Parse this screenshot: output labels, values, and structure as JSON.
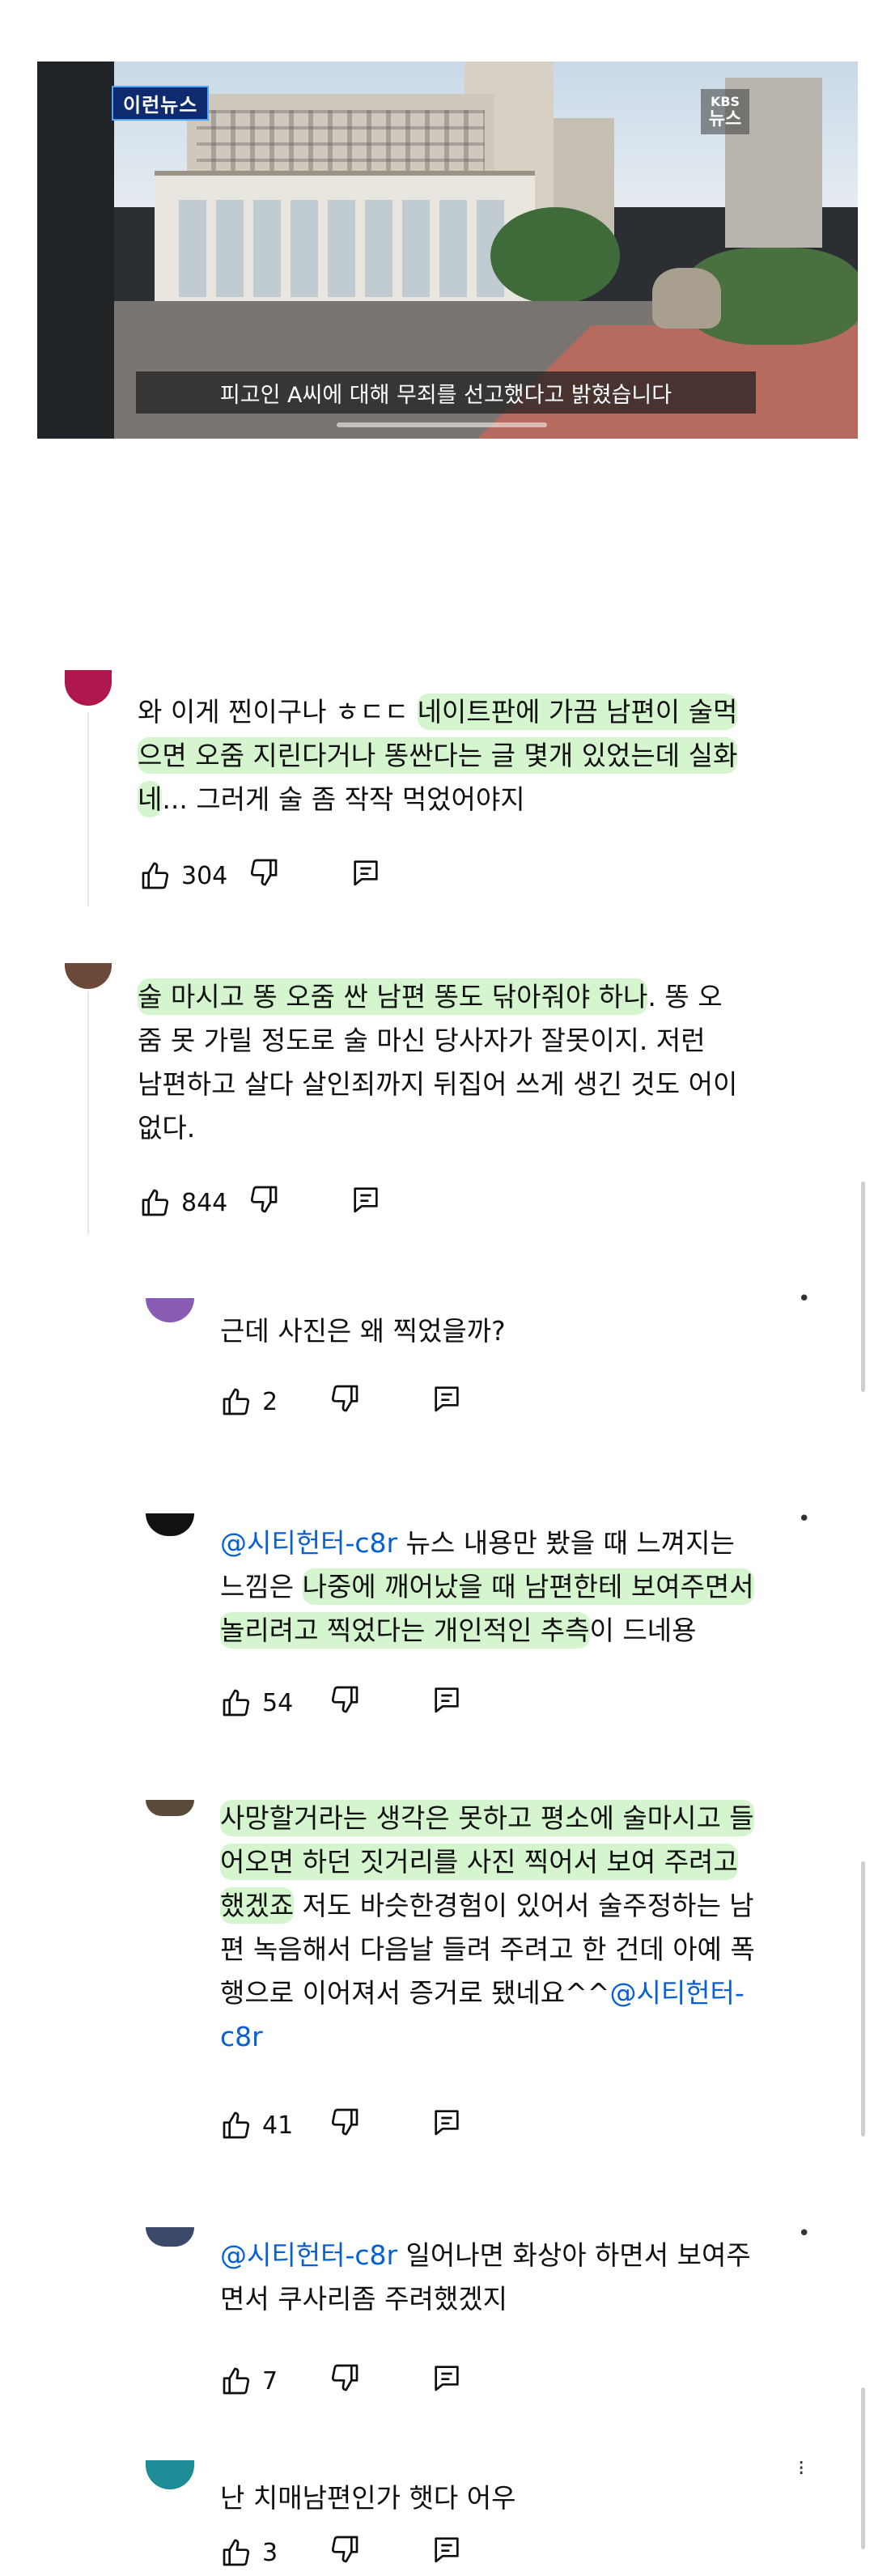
{
  "video": {
    "news_tag": "이런뉴스",
    "logo_top": "KBS",
    "logo_bottom": "뉴스",
    "subtitle": "피고인 A씨에 대해 무죄를 선고했다고 밝혔습니다"
  },
  "comments": [
    {
      "avatar_color": "#b0174e",
      "text_before": "와 이게 찐이구나 ㅎㄷㄷ ",
      "highlight_1": "네이트판에 가끔 남편이 술먹",
      "highlight_2": "으면 오줌 지린다거나 똥싼다는 글 몇개 있었는데 실화",
      "highlight_3": "네",
      "text_after": "... 그러게 술 좀 작작 먹었어야지",
      "likes": "304"
    },
    {
      "avatar_color": "#6b4a3a",
      "highlight_1": "술 마시고 똥 오줌 싼 남편 똥도 닦아줘야 하나",
      "line1_rest": ".   똥 오",
      "line2": "줌 못 가릴 정도로 술 마신 당사자가 잘못이지.   저런",
      "line3": "남편하고 살다 살인죄까지 뒤집어 쓰게 생긴 것도 어이",
      "line4": "없다.",
      "likes": "844"
    }
  ],
  "replies": [
    {
      "avatar_color": "#8a5bb5",
      "text": "근데 사진은 왜 찍었을까?",
      "likes": "2"
    },
    {
      "avatar_color": "#111111",
      "mention": "@시티헌터-c8r",
      "line1_rest": " 뉴스 내용만 봤을 때 느껴지는",
      "line2_a": "느낌은 ",
      "line2_hl": "나중에 깨어났을 때 남편한테 보여주면서",
      "line3_hl": "놀리려고 찍었다는 개인적인 추측",
      "line3_rest": "이 드네용",
      "likes": "54"
    },
    {
      "avatar_color": "#5a4a3a",
      "line1_hl": "사망할거라는 생각은 못하고 평소에 술마시고 들",
      "line2_hl": "어오면 하던 짓거리를 사진 찍어서 보여 주려고",
      "line3_hl": "했겠죠",
      "line3_rest": " 저도 바슷한경험이 있어서 술주정하는 남",
      "line4": "편 녹음해서 다음날 들려 주려고 한 건데 아예 폭",
      "line5": "행으로 이어져서 증거로 됐네요^^",
      "mention": "@시티헌터-",
      "mention_2": "c8r",
      "likes": "41"
    },
    {
      "avatar_color": "#3b4a6b",
      "mention": "@시티헌터-c8r",
      "line1_rest": " 일어나면 화상아 하면서 보여주",
      "line2": "면서 쿠사리좀 주려했겠지",
      "likes": "7"
    },
    {
      "avatar_color": "#1e8c96",
      "text": "난 치매남편인가 햇다 어우",
      "likes": "3"
    }
  ],
  "icons": {
    "like": "thumbs-up-icon",
    "dislike": "thumbs-down-icon",
    "reply": "reply-comment-icon",
    "menu": "more-vertical-icon"
  },
  "colors": {
    "mention": "#065fd4",
    "highlight": "#9ae68c"
  }
}
